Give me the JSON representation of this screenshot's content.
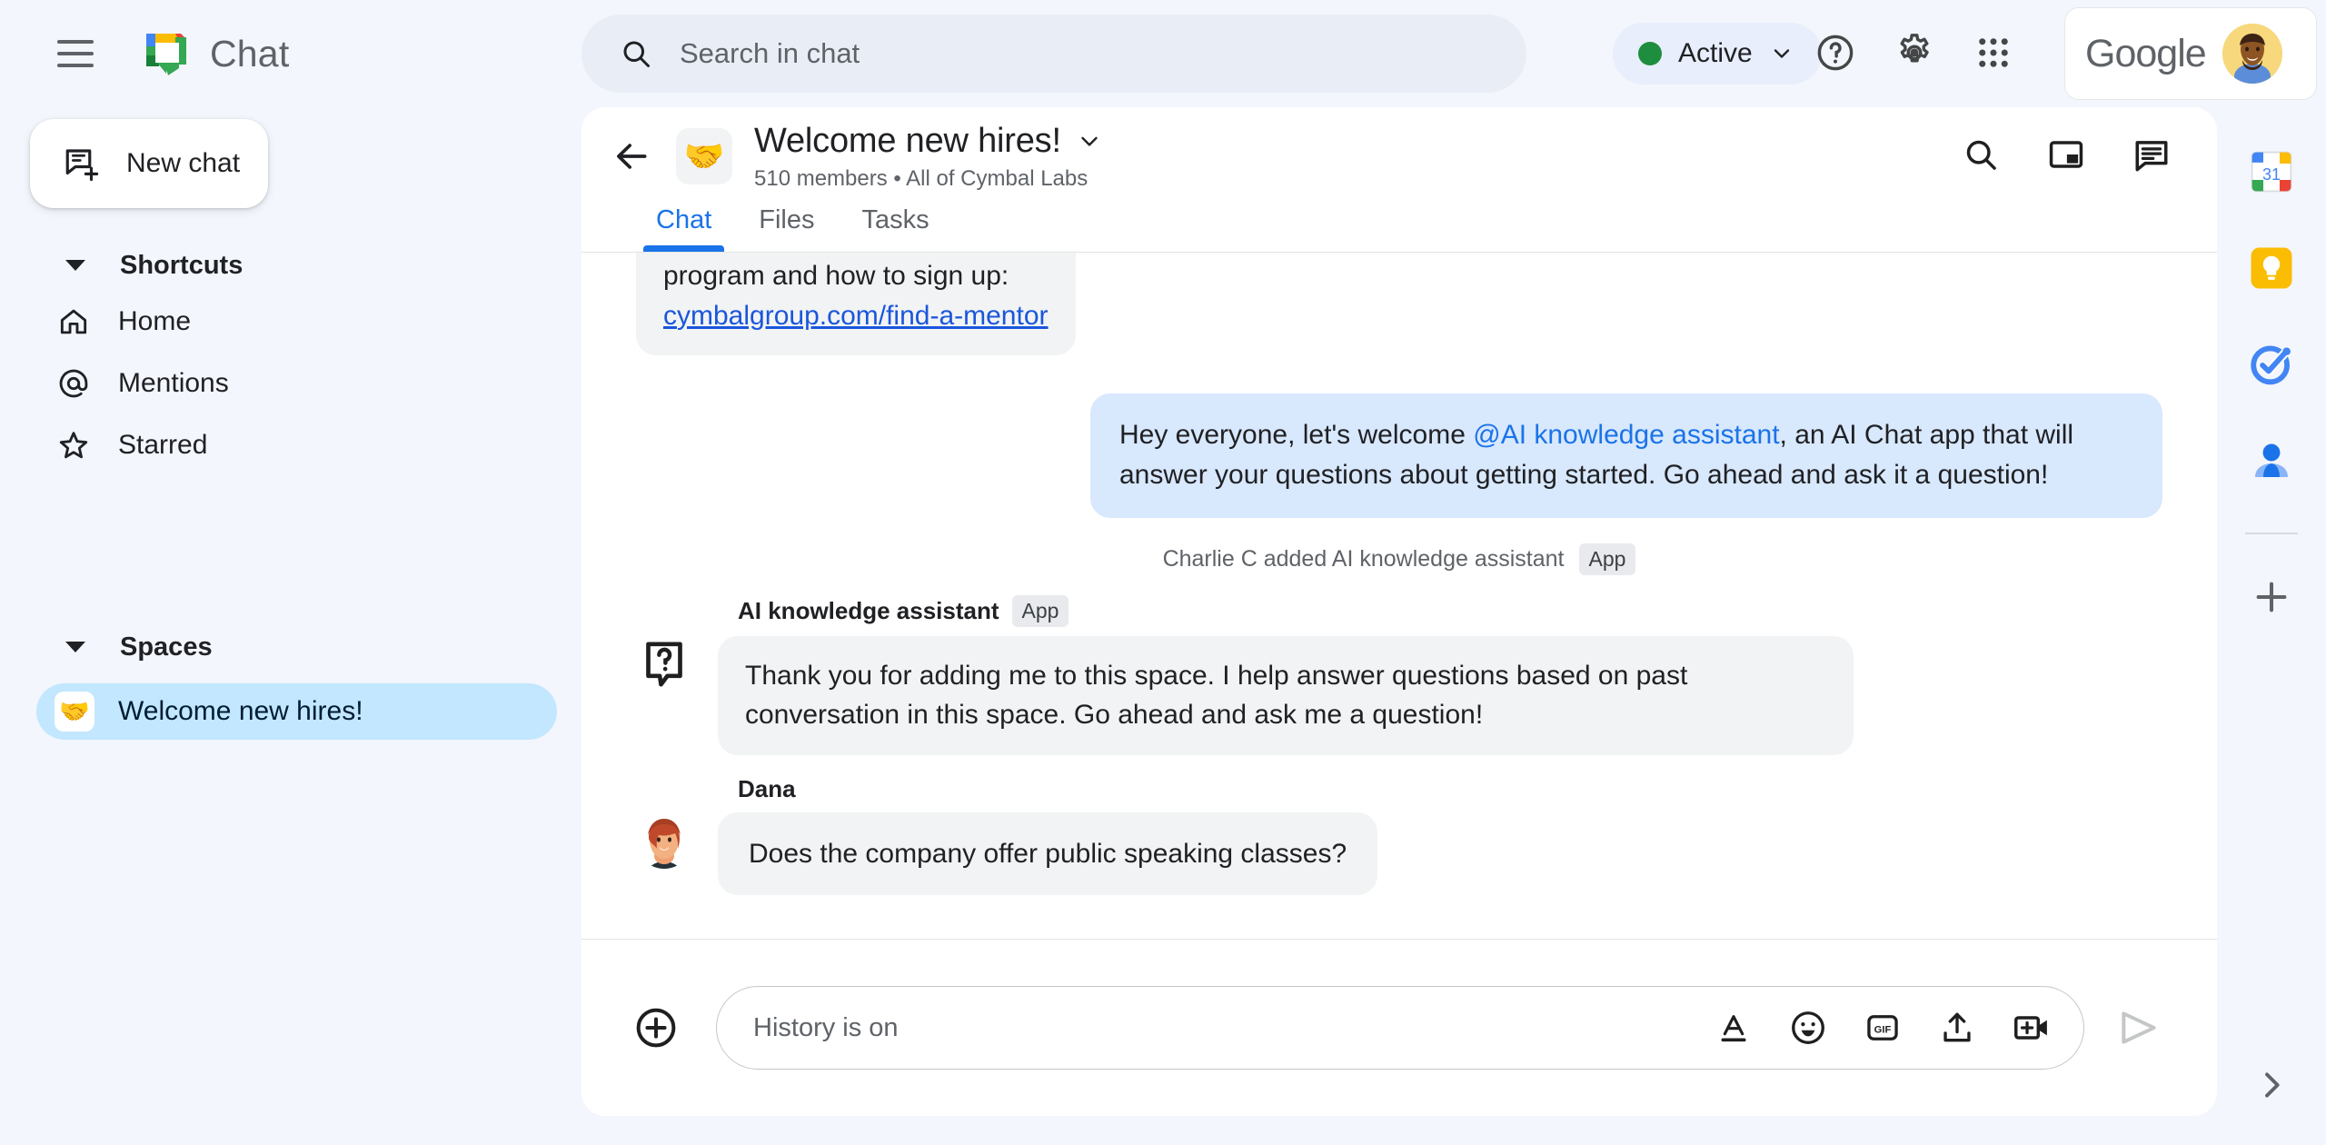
{
  "app": {
    "brand": "Chat",
    "hamburger_icon": "hamburger-menu-icon",
    "logo_icon": "google-chat-logo"
  },
  "search": {
    "placeholder": "Search in chat",
    "icon": "search-icon"
  },
  "status": {
    "label": "Active",
    "dot_color": "#1e8e3e",
    "chevron_icon": "chevron-down-icon"
  },
  "topbar_icons": {
    "help": "help-circle-icon",
    "settings": "gear-icon",
    "apps": "apps-grid-icon"
  },
  "account": {
    "google_wordmark": "Google",
    "avatar": "user-avatar"
  },
  "sidebar": {
    "new_chat": {
      "label": "New chat",
      "icon": "new-chat-icon"
    },
    "shortcuts": {
      "title": "Shortcuts",
      "items": [
        {
          "label": "Home",
          "icon": "home-icon"
        },
        {
          "label": "Mentions",
          "icon": "at-sign-icon"
        },
        {
          "label": "Starred",
          "icon": "star-icon"
        }
      ]
    },
    "spaces": {
      "title": "Spaces",
      "items": [
        {
          "label": "Welcome new hires!",
          "emoji": "🤝",
          "selected": true
        }
      ]
    }
  },
  "space": {
    "back_icon": "back-arrow-icon",
    "emoji": "🤝",
    "title": "Welcome new hires!",
    "title_chevron": "chevron-down-icon",
    "members": "510 members",
    "separator": "•",
    "org": "All of Cymbal Labs",
    "actions": [
      {
        "icon": "search-icon",
        "name": "search-in-space"
      },
      {
        "icon": "picture-in-picture-icon",
        "name": "pip-toggle"
      },
      {
        "icon": "thread-panel-icon",
        "name": "thread-panel"
      }
    ],
    "tabs": [
      {
        "label": "Chat",
        "active": true
      },
      {
        "label": "Files",
        "active": false
      },
      {
        "label": "Tasks",
        "active": false
      }
    ]
  },
  "conversation": {
    "clipped_message": {
      "line1": "program and how to sign up:",
      "link": "cymbalgroup.com/find-a-mentor"
    },
    "outgoing_message": {
      "prefix": "Hey everyone, let's welcome ",
      "mention": "@AI knowledge assistant",
      "suffix": ", an AI Chat app that will answer your questions about getting started.  Go ahead and ask it a question!"
    },
    "system_message": {
      "text": "Charlie C added AI knowledge assistant",
      "badge": "App"
    },
    "assistant_message": {
      "sender": "AI knowledge assistant",
      "badge": "App",
      "avatar_icon": "question-bubble-icon",
      "text": "Thank you for adding me to this space. I help answer questions based on past conversation in this space. Go ahead and ask me a question!"
    },
    "user_message": {
      "sender": "Dana",
      "avatar_icon": "dana-avatar",
      "text": "Does the company offer public speaking classes?"
    }
  },
  "composer": {
    "plus_icon": "add-attachment-icon",
    "placeholder": "History is on",
    "icons": [
      {
        "name": "format-text-icon",
        "glyph": "A"
      },
      {
        "name": "emoji-icon",
        "glyph": ""
      },
      {
        "name": "gif-icon",
        "glyph": "GIF"
      },
      {
        "name": "upload-file-icon",
        "glyph": ""
      },
      {
        "name": "add-video-icon",
        "glyph": ""
      }
    ],
    "send_icon": "send-icon"
  },
  "right_rail": {
    "items": [
      {
        "name": "google-calendar-icon",
        "label": "31"
      },
      {
        "name": "google-keep-icon",
        "label": ""
      },
      {
        "name": "google-tasks-icon",
        "label": ""
      },
      {
        "name": "google-contacts-icon",
        "label": ""
      }
    ],
    "add_icon": "add-app-icon",
    "expand_icon": "chevron-right-icon"
  },
  "colors": {
    "page_bg": "#f3f6fc",
    "panel_bg": "#ffffff",
    "accent_blue": "#1a73e8",
    "selected_space": "#c2e7ff",
    "bubble_in": "#f1f3f4",
    "bubble_out": "#d8e8fd",
    "status_green": "#1e8e3e"
  }
}
